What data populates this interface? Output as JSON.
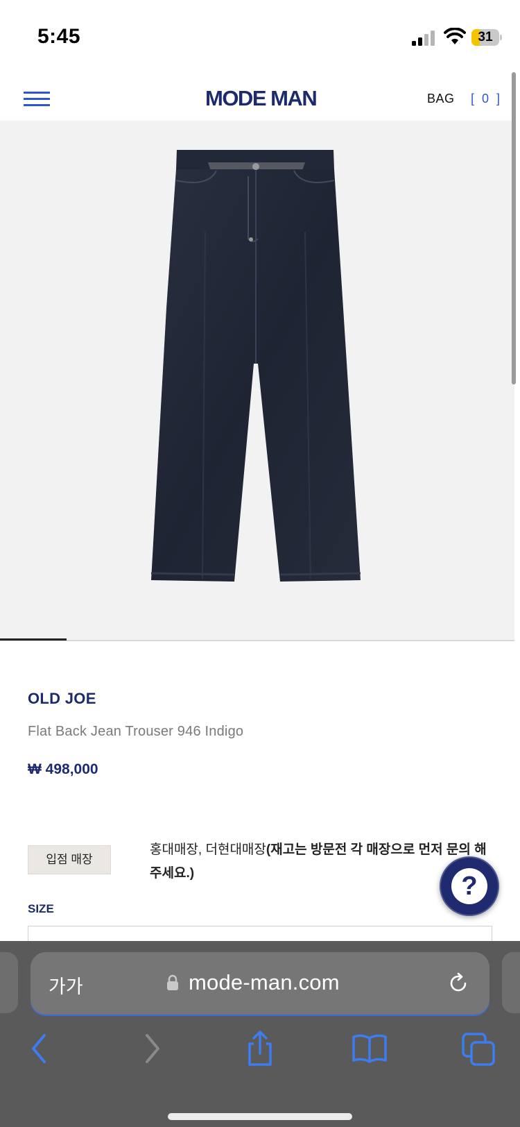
{
  "status_bar": {
    "time": "5:45",
    "battery": "31",
    "battery_level": 0.31,
    "icons": [
      "signal-icon",
      "wifi-icon",
      "battery-icon"
    ]
  },
  "header": {
    "logo": "MODE MAN",
    "bag_label": "BAG",
    "bag_count": "[ 0 ]",
    "icons": [
      "menu-icon"
    ],
    "accent_color": "#2f55d4",
    "brand_color": "#1d2a6b"
  },
  "gallery": {
    "progress": 0.13
  },
  "product": {
    "brand": "OLD JOE",
    "name": "Flat Back Jean Trouser 946 Indigo",
    "price": "₩ 498,000"
  },
  "store": {
    "badge": "입점 매장",
    "stores": "홍대매장, 더현대매장",
    "notice": "(재고는 방문전 각 매장으로 먼저 문의 해주세요.)"
  },
  "size": {
    "label": "SIZE"
  },
  "help": {
    "label": "?"
  },
  "browser": {
    "text_size_button": "가가",
    "url": "mode-man.com",
    "icons": [
      "lock-icon",
      "reload-icon",
      "back-icon",
      "forward-icon",
      "share-icon",
      "bookmarks-icon",
      "tabs-icon"
    ]
  }
}
